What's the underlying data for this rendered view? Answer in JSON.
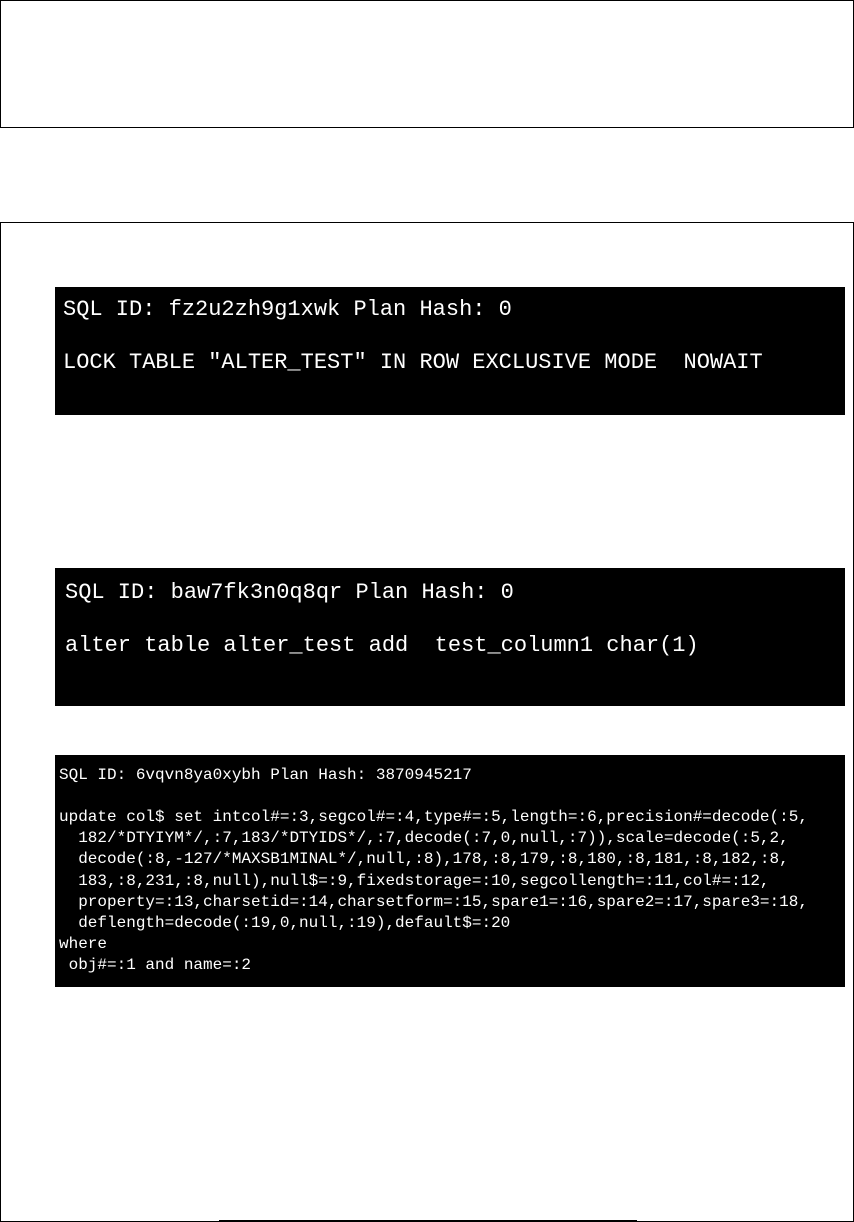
{
  "terminal1": {
    "line1": "SQL ID: fz2u2zh9g1xwk Plan Hash: 0",
    "line2": "LOCK TABLE \"ALTER_TEST\" IN ROW EXCLUSIVE MODE  NOWAIT"
  },
  "terminal2": {
    "line1": "SQL ID: baw7fk3n0q8qr Plan Hash: 0",
    "line2": "alter table alter_test add  test_column1 char(1)"
  },
  "terminal3": {
    "line1": "SQL ID: 6vqvn8ya0xybh Plan Hash: 3870945217",
    "line2": "update col$ set intcol#=:3,segcol#=:4,type#=:5,length=:6,precision#=decode(:5,",
    "line3": "  182/*DTYIYM*/,:7,183/*DTYIDS*/,:7,decode(:7,0,null,:7)),scale=decode(:5,2,",
    "line4": "  decode(:8,-127/*MAXSB1MINAL*/,null,:8),178,:8,179,:8,180,:8,181,:8,182,:8,",
    "line5": "  183,:8,231,:8,null),null$=:9,fixedstorage=:10,segcollength=:11,col#=:12,",
    "line6": "  property=:13,charsetid=:14,charsetform=:15,spare1=:16,spare2=:17,spare3=:18,",
    "line7": "  deflength=decode(:19,0,null,:19),default$=:20",
    "line8": "where",
    "line9": " obj#=:1 and name=:2"
  }
}
